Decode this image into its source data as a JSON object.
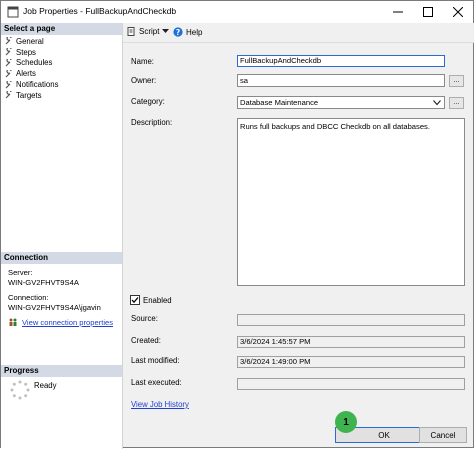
{
  "window": {
    "title": "Job Properties - FullBackupAndCheckdb"
  },
  "left_pane": {
    "select_page_header": "Select a page",
    "pages": [
      {
        "label": "General",
        "icon": "wrench-icon"
      },
      {
        "label": "Steps",
        "icon": "wrench-icon"
      },
      {
        "label": "Schedules",
        "icon": "wrench-icon"
      },
      {
        "label": "Alerts",
        "icon": "wrench-icon"
      },
      {
        "label": "Notifications",
        "icon": "wrench-icon"
      },
      {
        "label": "Targets",
        "icon": "wrench-icon"
      }
    ],
    "connection_header": "Connection",
    "server_label": "Server:",
    "server_value": "WIN-GV2FHVT9S4A",
    "connection_label": "Connection:",
    "connection_value": "WIN-GV2FHVT9S4A\\jgavin",
    "view_connection_link": "View connection properties",
    "progress_header": "Progress",
    "progress_status": "Ready"
  },
  "toolbar": {
    "script_label": "Script",
    "help_label": "Help"
  },
  "form": {
    "name_label": "Name:",
    "name_value": "FullBackupAndCheckdb",
    "owner_label": "Owner:",
    "owner_value": "sa",
    "owner_browse": "...",
    "category_label": "Category:",
    "category_value": "Database Maintenance",
    "category_browse": "...",
    "description_label": "Description:",
    "description_value": "Runs full backups and DBCC Checkdb on all databases.",
    "enabled_label": "Enabled",
    "enabled_checked": true,
    "source_label": "Source:",
    "source_value": "",
    "created_label": "Created:",
    "created_value": "3/6/2024 1:45:57 PM",
    "last_modified_label": "Last modified:",
    "last_modified_value": "3/6/2024 1:49:00 PM",
    "last_executed_label": "Last executed:",
    "last_executed_value": "",
    "view_job_history_link": "View Job History"
  },
  "buttons": {
    "ok_label": "OK",
    "cancel_label": "Cancel"
  },
  "annotation": {
    "badge_number": "1",
    "badge_color": "#3fb34f"
  },
  "colors": {
    "section_header_bg": "#d3dae6",
    "link": "#1f3fd0",
    "focus_border": "#2a6bd6"
  }
}
